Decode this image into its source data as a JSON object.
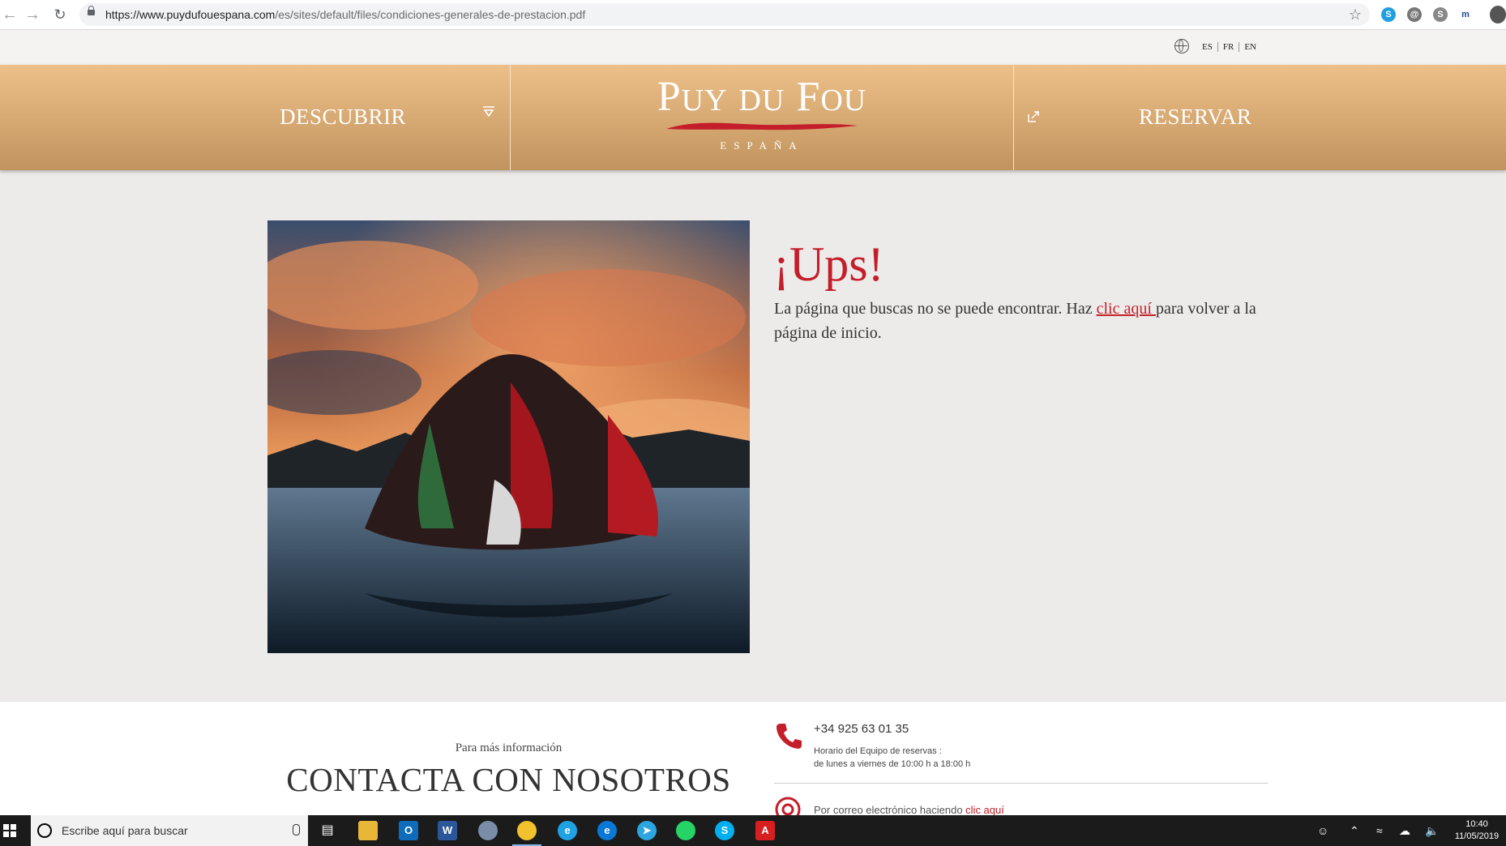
{
  "browser": {
    "url_host": "https://www.puydufouespana.com",
    "url_path": "/es/sites/default/files/condiciones-generales-de-prestacion.pdf"
  },
  "topbar": {
    "languages": [
      "ES",
      "FR",
      "EN"
    ]
  },
  "nav": {
    "discover_label": "DESCUBRIR",
    "book_label": "RESERVAR",
    "logo_text_1": "P",
    "logo_text_2": "UY",
    "logo_text_3": "DU",
    "logo_text_4": "F",
    "logo_text_5": "OU",
    "logo_sub": "ESPAÑA"
  },
  "error": {
    "title": "¡Ups!",
    "message_before": "La página que buscas no se puede encontrar. Haz ",
    "link_text": "clic aquí ",
    "message_after": "para volver a la página de inicio."
  },
  "footer": {
    "more_info": "Para más información",
    "contact_title": "CONTACTA CON NOSOTROS",
    "phone": "+34 925 63 01 35",
    "hours_line1": "Horario del Equipo de reservas :",
    "hours_line2": "de lunes a viernes de 10:00 h a 18:00 h",
    "email_text": "Por correo electrónico haciendo ",
    "email_link": "clic aquí"
  },
  "taskbar": {
    "search_placeholder": "Escribe aquí para buscar",
    "time": "10:40",
    "date": "11/05/2019"
  },
  "colors": {
    "brand_red": "#c41e2b",
    "nav_gold_top": "#eec089",
    "nav_gold_bottom": "#c1935e",
    "page_bg": "#edebe9"
  }
}
